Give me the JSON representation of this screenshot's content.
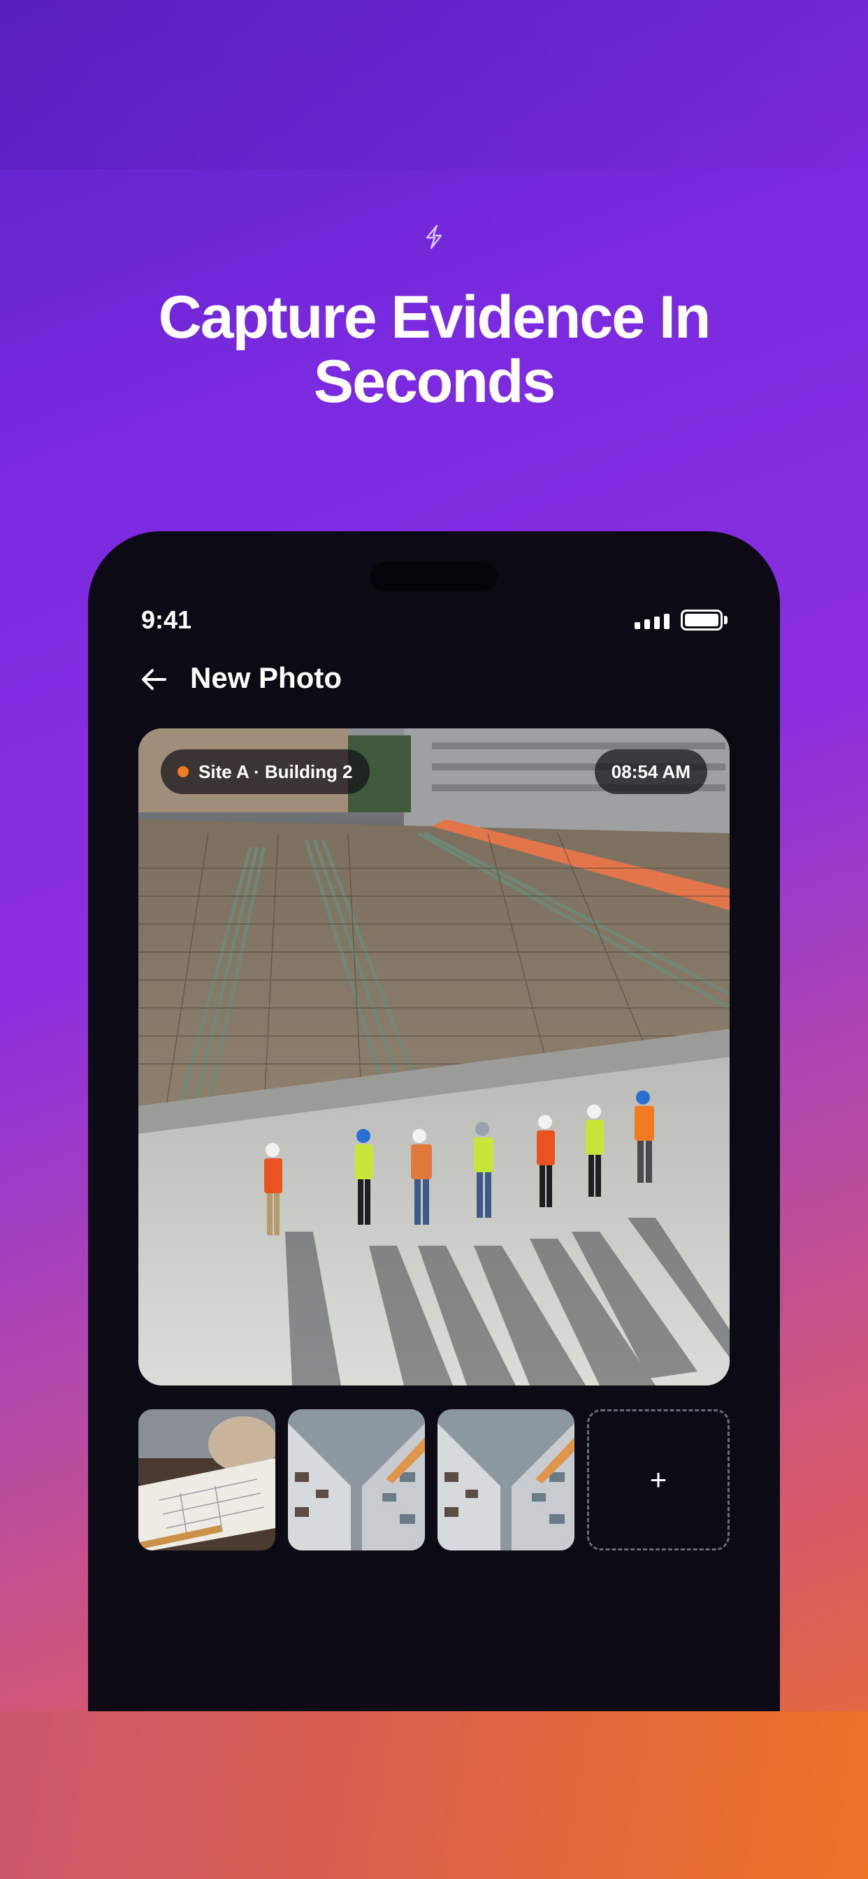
{
  "promo": {
    "headline_line1": "Capture Evidence In",
    "headline_line2": "Seconds",
    "icon": "lightning-bolt-icon"
  },
  "status_bar": {
    "time": "9:41"
  },
  "header": {
    "back_icon": "arrow-left-icon",
    "title": "New Photo"
  },
  "photo": {
    "site_label": "Site A · Building 2",
    "timestamp": "08:54 AM",
    "site_dot_color": "#f07b22"
  },
  "thumbnails": [
    {
      "subject": "blueprint-drawing"
    },
    {
      "subject": "building-facade"
    },
    {
      "subject": "building-facade"
    }
  ],
  "add_button": {
    "label": "+"
  },
  "colors": {
    "phone_bg": "#0c0a14",
    "gradient_top": "#5a22c4",
    "gradient_bottom": "#ec7224"
  }
}
